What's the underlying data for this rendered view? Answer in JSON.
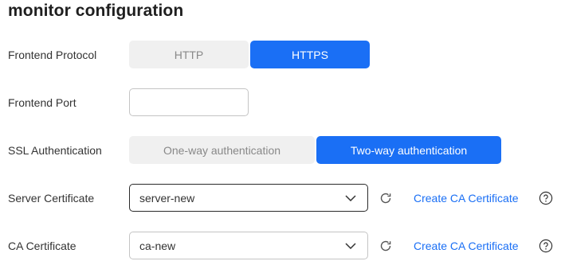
{
  "section_title": "monitor configuration",
  "protocol": {
    "label": "Frontend Protocol",
    "options": [
      "HTTP",
      "HTTPS"
    ],
    "selected": "HTTPS"
  },
  "port": {
    "label": "Frontend Port",
    "value": ""
  },
  "ssl": {
    "label": "SSL Authentication",
    "options": [
      "One-way authentication",
      "Two-way authentication"
    ],
    "selected": "Two-way authentication"
  },
  "server_cert": {
    "label": "Server Certificate",
    "value": "server-new",
    "link": "Create CA Certificate"
  },
  "ca_cert": {
    "label": "CA Certificate",
    "value": "ca-new",
    "link": "Create CA Certificate"
  },
  "colors": {
    "accent": "#1a6ff5",
    "segment_off": "#f0f0f0"
  },
  "icons": [
    "chevron-down-icon",
    "refresh-icon",
    "help-icon"
  ]
}
